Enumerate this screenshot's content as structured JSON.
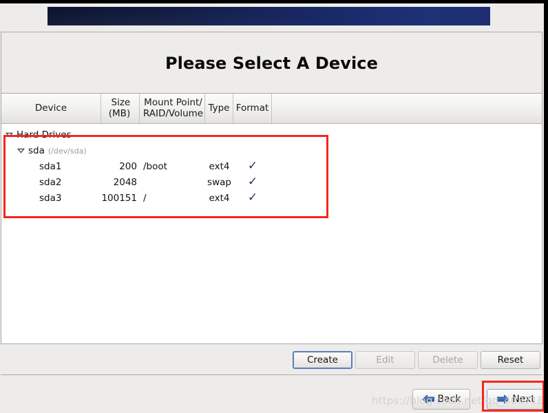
{
  "window": {
    "title": "Please Select A Device"
  },
  "table": {
    "columns": [
      {
        "id": "device",
        "label": "Device"
      },
      {
        "id": "size",
        "label": "Size\n(MB)",
        "label_line1": "Size",
        "label_line2": "(MB)"
      },
      {
        "id": "mount",
        "label": "Mount Point/\nRAID/Volume",
        "label_line1": "Mount Point/",
        "label_line2": "RAID/Volume"
      },
      {
        "id": "type",
        "label": "Type"
      },
      {
        "id": "format",
        "label": "Format"
      }
    ],
    "groups": [
      {
        "label": "Hard Drives",
        "expander": "expander-open-icon",
        "children": [
          {
            "label": "sda",
            "path": "(/dev/sda)",
            "expander": "expander-open-icon",
            "partitions": [
              {
                "device": "sda1",
                "size": "200",
                "mount": "/boot",
                "type": "ext4",
                "format": "✓"
              },
              {
                "device": "sda2",
                "size": "2048",
                "mount": "",
                "type": "swap",
                "format": "✓"
              },
              {
                "device": "sda3",
                "size": "100151",
                "mount": "/",
                "type": "ext4",
                "format": "✓"
              }
            ]
          }
        ]
      }
    ]
  },
  "actions": {
    "create": "Create",
    "edit": "Edit",
    "delete": "Delete",
    "reset": "Reset"
  },
  "navigation": {
    "back": "Back",
    "next": "Next"
  },
  "watermark": "https://blog.csdn.net/qq_40371856",
  "colors": {
    "banner_dark": "#0d1430",
    "banner_light": "#1e3176",
    "annotation_red": "#f3271e",
    "checkmark": "#273257",
    "nav_arrow_blue": "#3566b0",
    "window_bg": "#edecea",
    "table_bg": "#ffffff"
  }
}
